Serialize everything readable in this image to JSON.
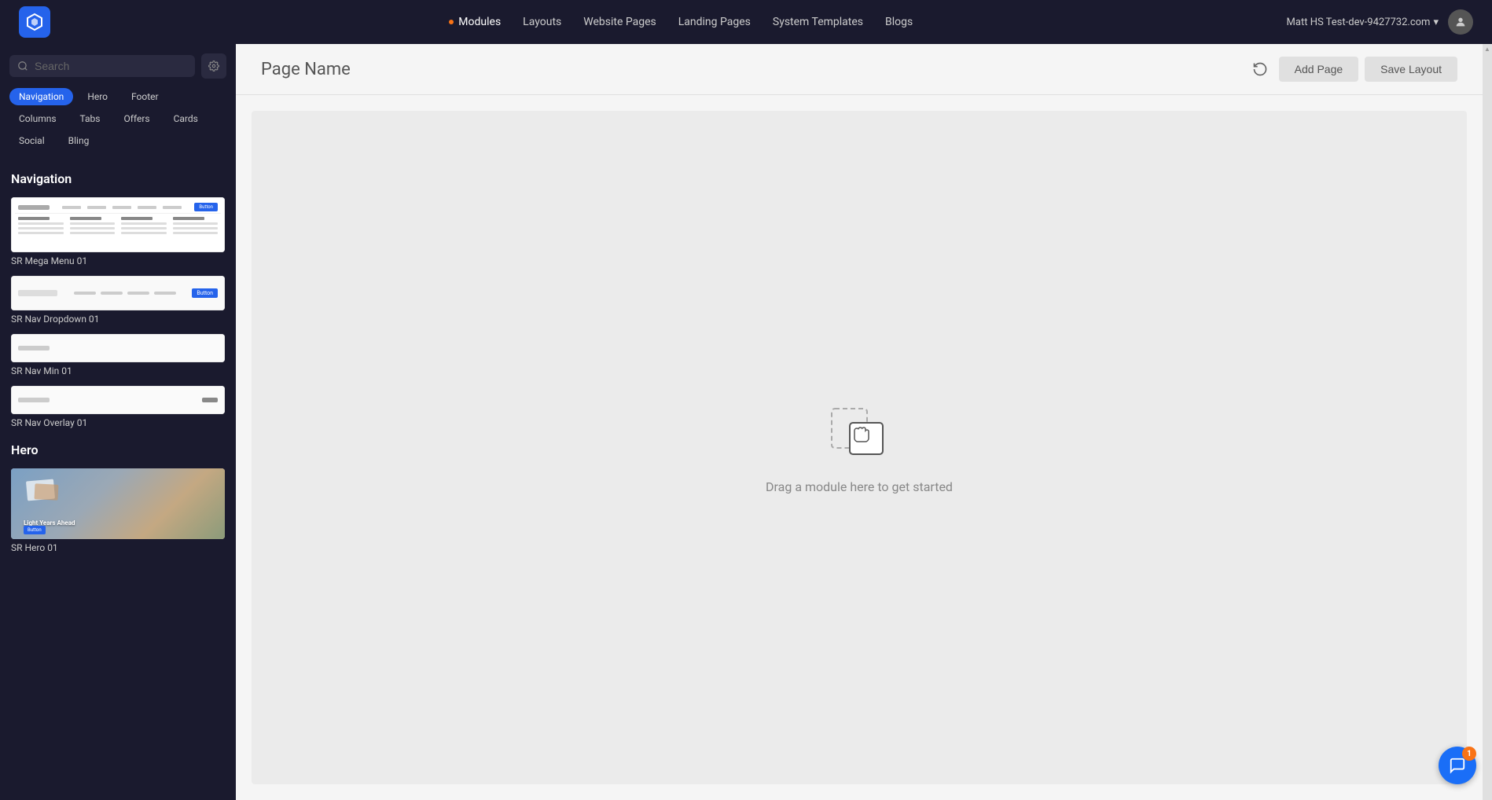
{
  "topbar": {
    "nav_items": [
      {
        "id": "modules",
        "label": "Modules",
        "active": true,
        "dot": true
      },
      {
        "id": "layouts",
        "label": "Layouts",
        "active": false,
        "dot": false
      },
      {
        "id": "website-pages",
        "label": "Website Pages",
        "active": false,
        "dot": false
      },
      {
        "id": "landing-pages",
        "label": "Landing Pages",
        "active": false,
        "dot": false
      },
      {
        "id": "system-templates",
        "label": "System Templates",
        "active": false,
        "dot": false
      },
      {
        "id": "blogs",
        "label": "Blogs",
        "active": false,
        "dot": false
      }
    ],
    "account_label": "Matt HS Test-dev-9427732.com",
    "logo_alt": "App Logo"
  },
  "sidebar": {
    "search_placeholder": "Search",
    "tags": [
      {
        "id": "navigation",
        "label": "Navigation",
        "active": true
      },
      {
        "id": "hero",
        "label": "Hero",
        "active": false
      },
      {
        "id": "footer",
        "label": "Footer",
        "active": false
      },
      {
        "id": "columns",
        "label": "Columns",
        "active": false
      },
      {
        "id": "tabs",
        "label": "Tabs",
        "active": false
      },
      {
        "id": "offers",
        "label": "Offers",
        "active": false
      },
      {
        "id": "cards",
        "label": "Cards",
        "active": false
      },
      {
        "id": "social",
        "label": "Social",
        "active": false
      },
      {
        "id": "bling",
        "label": "Bling",
        "active": false
      }
    ],
    "navigation_section_label": "Navigation",
    "hero_section_label": "Hero",
    "modules": [
      {
        "id": "sr-mega-menu-01",
        "name": "SR Mega Menu 01",
        "type": "mega"
      },
      {
        "id": "sr-nav-dropdown-01",
        "name": "SR Nav Dropdown 01",
        "type": "nav-dropdown"
      },
      {
        "id": "sr-nav-min-01",
        "name": "SR Nav Min 01",
        "type": "nav-min"
      },
      {
        "id": "sr-nav-overlay-01",
        "name": "SR Nav Overlay 01",
        "type": "nav-overlay"
      }
    ],
    "hero_modules": [
      {
        "id": "sr-hero-01",
        "name": "SR Hero 01",
        "type": "hero"
      }
    ]
  },
  "content": {
    "page_title": "Page Name",
    "add_page_label": "Add Page",
    "save_layout_label": "Save Layout",
    "drop_zone_text": "Drag a module here to get started"
  },
  "chat": {
    "badge_count": "1"
  }
}
